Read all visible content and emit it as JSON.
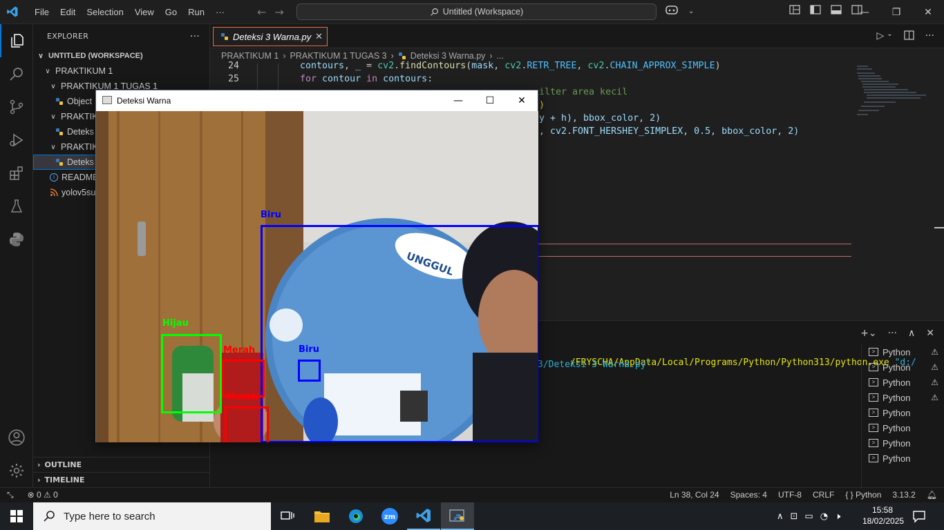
{
  "titlebar": {
    "menu": [
      "File",
      "Edit",
      "Selection",
      "View",
      "Go",
      "Run",
      "···"
    ],
    "search_text": "Untitled (Workspace)"
  },
  "sidebar": {
    "header": "EXPLORER",
    "workspace": "UNTITLED (WORKSPACE)",
    "items": [
      {
        "label": "PRAKTIKUM 1"
      },
      {
        "label": "PRAKTIKUM 1 TUGAS 1"
      },
      {
        "label": "Object"
      },
      {
        "label": "PRAKTIK"
      },
      {
        "label": "Deteks"
      },
      {
        "label": "PRAKTIK"
      },
      {
        "label": "Deteks"
      },
      {
        "label": "README"
      },
      {
        "label": "yolov5su"
      }
    ],
    "outline": "OUTLINE",
    "timeline": "TIMELINE"
  },
  "editor": {
    "tab_label": "Deteksi 3 Warna.py",
    "breadcrumb": [
      "PRAKTIKUM 1",
      "PRAKTIKUM 1 TUGAS 3",
      "Deteksi 3 Warna.py",
      "..."
    ],
    "lines": [
      {
        "num": "24",
        "text": "contours, _ = cv2.findContours(mask, cv2.RETR_TREE, cv2.CHAIN_APPROX_SIMPLE)"
      },
      {
        "num": "25",
        "text": "for contour in contours:"
      },
      {
        "num": "",
        "text": "ilter area kecil"
      },
      {
        "num": "",
        "text": ")"
      },
      {
        "num": "",
        "text": "y + h), bbox_color, 2)"
      },
      {
        "num": "",
        "text": ", cv2.FONT_HERSHEY_SIMPLEX, 0.5, bbox_color, 2)"
      }
    ]
  },
  "terminal": {
    "line1_path": "/FRYSCHA/AppData/Local/Programs/Python/Python313/python.exe",
    "line1_arg": "\"d:/",
    "line2": "3/Deteksi 3 Warna.py\"",
    "sessions": [
      "Python",
      "Python",
      "Python",
      "Python",
      "Python",
      "Python",
      "Python",
      "Python"
    ],
    "warnings": [
      true,
      true,
      true,
      true,
      false,
      false,
      false,
      false
    ]
  },
  "statusbar": {
    "errors": "0",
    "warnings": "0",
    "position": "Ln 38, Col 24",
    "spaces": "Spaces: 4",
    "encoding": "UTF-8",
    "eol": "CRLF",
    "language": "Python",
    "version": "3.13.2"
  },
  "cv_window": {
    "title": "Deteksi Warna",
    "detections": [
      {
        "label": "Biru",
        "color": "#0000ff"
      },
      {
        "label": "Biru",
        "color": "#0000ff"
      },
      {
        "label": "Hijau",
        "color": "#00ff00"
      },
      {
        "label": "Merah",
        "color": "#ff0000"
      },
      {
        "label": "Merah",
        "color": "#ff0000"
      }
    ],
    "badge_text": "UNGGUL"
  },
  "taskbar": {
    "search_placeholder": "Type here to search",
    "time": "15:58",
    "date": "18/02/2025"
  },
  "colors": {
    "accent": "#0078d4",
    "keyword": "#c586c0",
    "variable": "#9cdcfe",
    "function": "#dcdcaa",
    "class": "#4ec9b0",
    "comment": "#6a9955",
    "string": "#ce9178"
  }
}
